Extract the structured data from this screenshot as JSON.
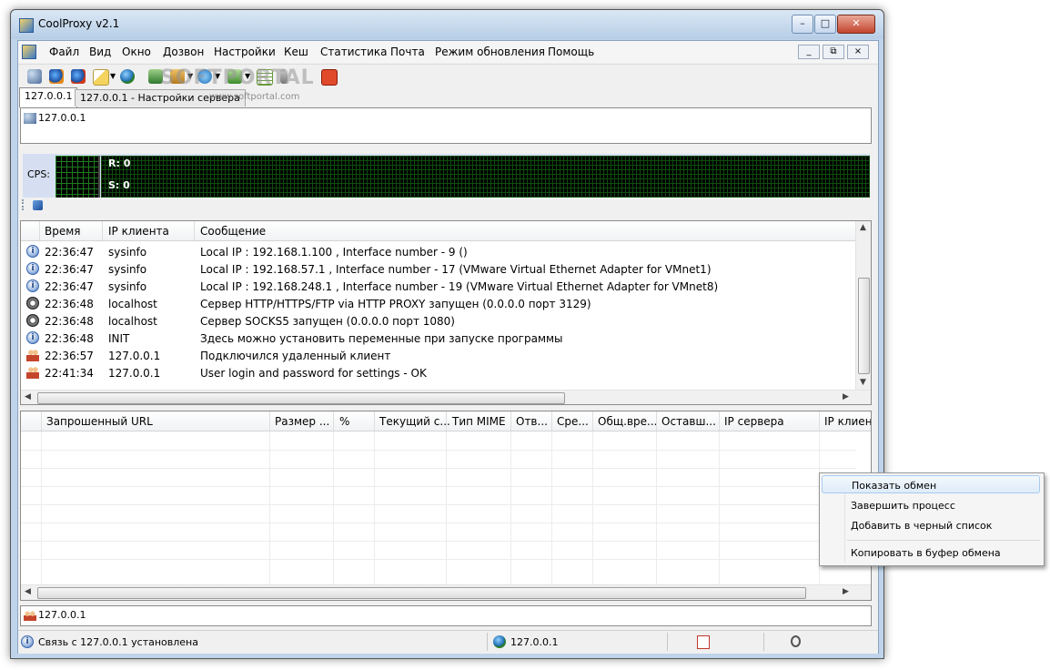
{
  "window": {
    "title": "CoolProxy v2.1",
    "controls": {
      "minimize": "–",
      "maximize": "□",
      "close": "✕"
    }
  },
  "menu": {
    "items": [
      "Файл",
      "Вид",
      "Окно",
      "Дозвон",
      "Настройки",
      "Кеш",
      "Статистика",
      "Почта",
      "Режим обновления",
      "Помощь"
    ],
    "mdi_controls": {
      "minimize": "_",
      "restore": "⧉",
      "close": "×"
    }
  },
  "tabs": [
    {
      "label": "127.0.0.1",
      "active": true
    },
    {
      "label": "127.0.0.1 - Настройки сервера",
      "active": false
    }
  ],
  "watermark": {
    "main": "SOFTPORTAL",
    "sub": "www.softportal.com"
  },
  "top_address": "127.0.0.1",
  "cps": {
    "label": "CPS:",
    "r": "R: 0",
    "s": "S: 0"
  },
  "log": {
    "columns": [
      "Время",
      "IP клиента",
      "Сообщение"
    ],
    "rows": [
      {
        "icon": "info-icon",
        "time": "22:36:47",
        "ip": "sysinfo",
        "message": "Local IP    : 192.168.1.100 , Interface number - 9 ()"
      },
      {
        "icon": "info-icon",
        "time": "22:36:47",
        "ip": "sysinfo",
        "message": "Local IP    : 192.168.57.1 , Interface number - 17 (VMware Virtual Ethernet Adapter for VMnet1)"
      },
      {
        "icon": "info-icon",
        "time": "22:36:47",
        "ip": "sysinfo",
        "message": "Local IP    : 192.168.248.1 , Interface number - 19 (VMware Virtual Ethernet Adapter for VMnet8)"
      },
      {
        "icon": "gear-icon",
        "time": "22:36:48",
        "ip": "localhost",
        "message": "Сервер HTTP/HTTPS/FTP via HTTP PROXY запущен (0.0.0.0 порт 3129)"
      },
      {
        "icon": "gear-icon",
        "time": "22:36:48",
        "ip": "localhost",
        "message": "Сервер SOCKS5 запущен (0.0.0.0 порт 1080)"
      },
      {
        "icon": "info-icon",
        "time": "22:36:48",
        "ip": "INIT",
        "message": "Здесь можно установить переменные при запуске программы"
      },
      {
        "icon": "users-icon",
        "time": "22:36:57",
        "ip": "127.0.0.1",
        "message": "Подключился удаленный клиент"
      },
      {
        "icon": "users-icon",
        "time": "22:41:34",
        "ip": "127.0.0.1",
        "message": "User login and password for settings - OK"
      }
    ]
  },
  "connections": {
    "columns": [
      "Запрошенный URL",
      "Размер ...",
      "%",
      "Текущий с...",
      "Тип MIME",
      "Отв...",
      "Сре...",
      "Общ.вре...",
      "Оставш...",
      "IP сервера",
      "IP клиент"
    ]
  },
  "bottom_address": "127.0.0.1",
  "status": {
    "message": "Связь с 127.0.0.1 установлена",
    "host": "127.0.0.1"
  },
  "context_menu": {
    "items": [
      "Показать обмен",
      "Завершить процесс",
      "Добавить в черный список",
      "Копировать в буфер обмена"
    ],
    "highlighted_index": 0
  },
  "colors": {
    "accent": "#3a68b0",
    "graph_grid": "#1f7a1f",
    "graph_bg": "#000000"
  }
}
